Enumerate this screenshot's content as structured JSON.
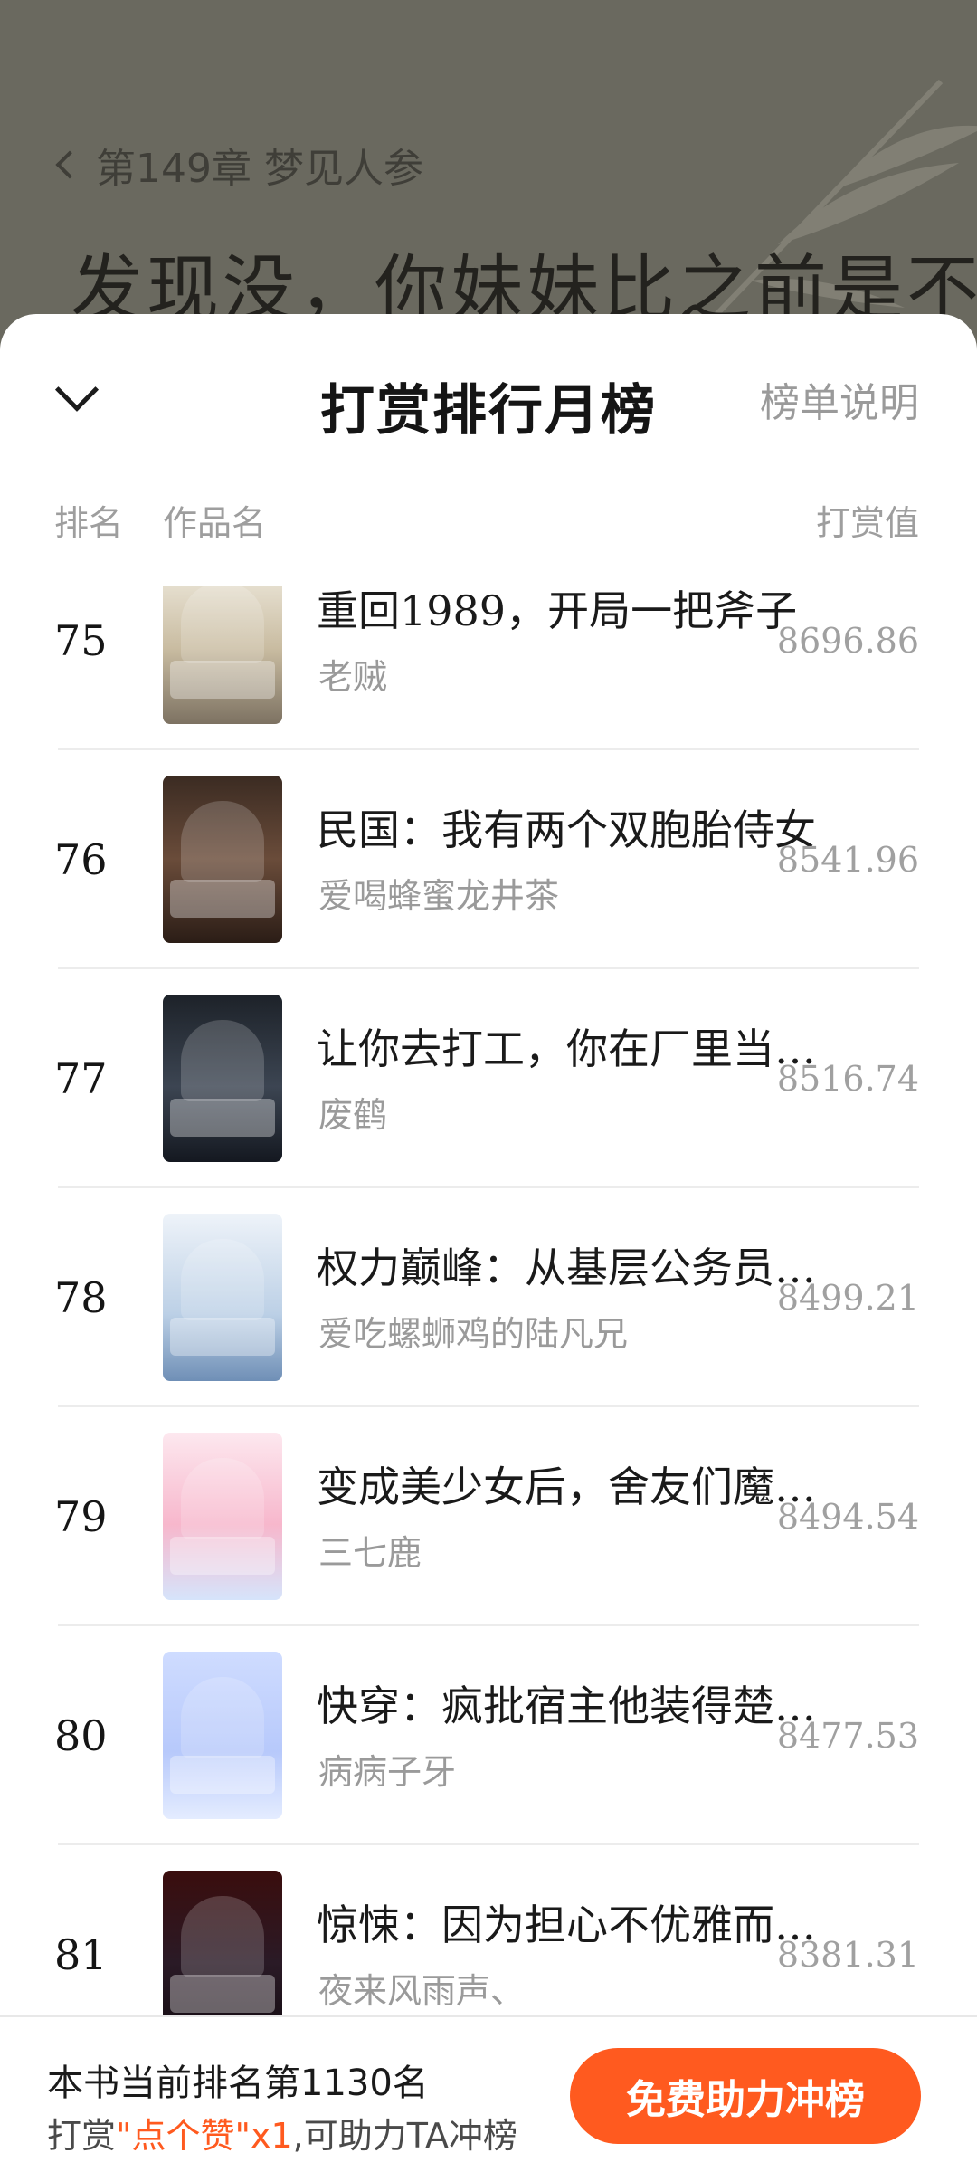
{
  "reader": {
    "chapter_title": "第149章 梦见人参",
    "body_text": "发现没，你妹妹比之前是不"
  },
  "sheet": {
    "title": "打赏排行月榜",
    "rules_link": "榜单说明",
    "columns": {
      "rank": "排名",
      "name": "作品名",
      "value": "打赏值"
    }
  },
  "rows": [
    {
      "rank": "75",
      "title": "重回1989，开局一把斧子",
      "author": "老贼",
      "value": "8696.86",
      "cover_icon": "book-cover-75"
    },
    {
      "rank": "76",
      "title": "民国：我有两个双胞胎侍女",
      "author": "爱喝蜂蜜龙井茶",
      "value": "8541.96",
      "cover_icon": "book-cover-76"
    },
    {
      "rank": "77",
      "title": "让你去打工，你在厂里当…",
      "author": "废鹤",
      "value": "8516.74",
      "cover_icon": "book-cover-77"
    },
    {
      "rank": "78",
      "title": "权力巅峰：从基层公务员…",
      "author": "爱吃螺蛳鸡的陆凡兄",
      "value": "8499.21",
      "cover_icon": "book-cover-78"
    },
    {
      "rank": "79",
      "title": "变成美少女后，舍友们魔…",
      "author": "三七鹿",
      "value": "8494.54",
      "cover_icon": "book-cover-79"
    },
    {
      "rank": "80",
      "title": "快穿：疯批宿主他装得楚…",
      "author": "病病子牙",
      "value": "8477.53",
      "cover_icon": "book-cover-80"
    },
    {
      "rank": "81",
      "title": "惊悚：因为担心不优雅而…",
      "author": "夜来风雨声、",
      "value": "8381.31",
      "cover_icon": "book-cover-81"
    }
  ],
  "footer": {
    "current_rank": "本书当前排名第1130名",
    "tip_prefix": "打赏",
    "tip_highlight": "\"点个赞\"x1",
    "tip_suffix": ",可助力TA冲榜",
    "boost_button": "免费助力冲榜"
  },
  "colors": {
    "accent": "#ff5a1f",
    "sheet_bg": "#ffffff",
    "backdrop": "#6a695f"
  }
}
